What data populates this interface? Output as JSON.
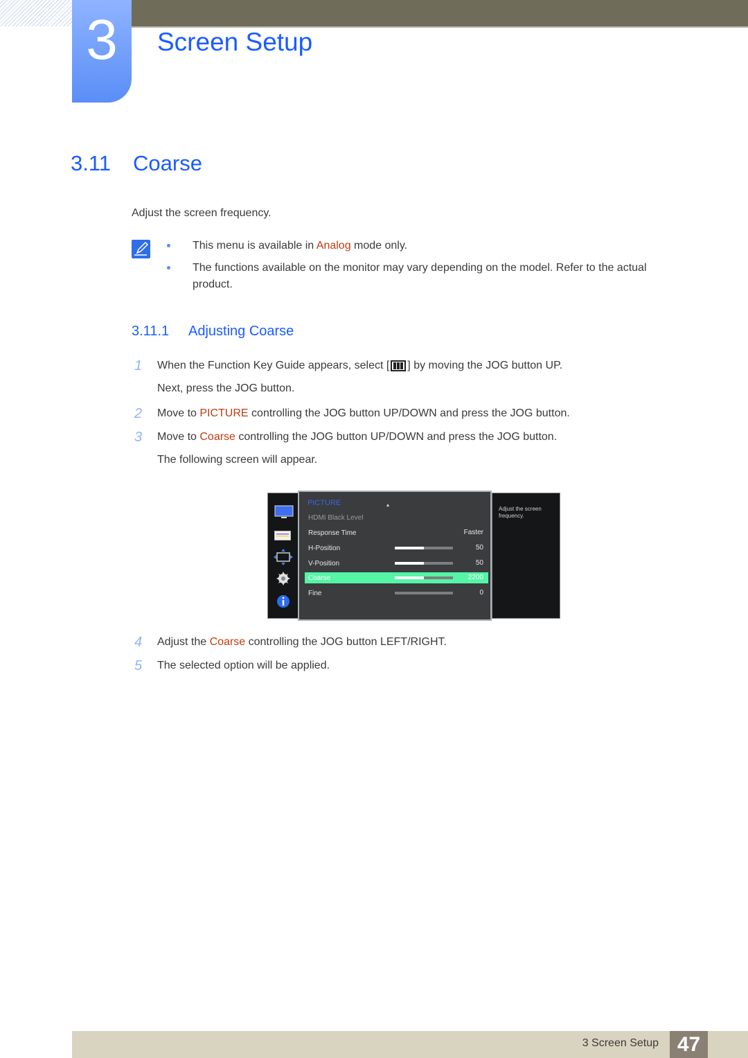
{
  "chapter": {
    "number": "3",
    "title": "Screen Setup"
  },
  "section": {
    "number": "3.11",
    "title": "Coarse",
    "intro": "Adjust the screen frequency."
  },
  "notes": [
    {
      "before": "This menu is available in ",
      "highlight": "Analog",
      "after": " mode only."
    },
    {
      "before": "The functions available on the monitor may vary depending on the model. Refer to the actual product.",
      "highlight": "",
      "after": ""
    }
  ],
  "subsection": {
    "number": "3.11.1",
    "title": "Adjusting Coarse"
  },
  "steps": [
    {
      "n": "1",
      "before": "When the Function Key Guide appears, select [",
      "after": "] by moving the JOG button UP.",
      "cont": "Next, press the JOG button."
    },
    {
      "n": "2",
      "before": "Move to ",
      "highlight": "PICTURE",
      "after": " controlling the JOG button UP/DOWN and press the JOG button."
    },
    {
      "n": "3",
      "before": "Move to ",
      "highlight": "Coarse",
      "after": " controlling the JOG button UP/DOWN and press the JOG button.",
      "cont": "The following screen will appear."
    },
    {
      "n": "4",
      "before": "Adjust the ",
      "highlight": "Coarse",
      "after": " controlling the JOG button LEFT/RIGHT."
    },
    {
      "n": "5",
      "before": "The selected option will be applied."
    }
  ],
  "osd": {
    "menu_title": "PICTURE",
    "icons": [
      "monitor-icon",
      "picture-settings-icon",
      "resize-icon",
      "gear-icon",
      "info-icon"
    ],
    "rows": [
      {
        "label": "HDMI Black Level",
        "value": "",
        "bar": null,
        "state": "disabled"
      },
      {
        "label": "Response Time",
        "value": "Faster",
        "bar": null,
        "state": "normal"
      },
      {
        "label": "H-Position",
        "value": "50",
        "bar": 0.5,
        "state": "normal"
      },
      {
        "label": "V-Position",
        "value": "50",
        "bar": 0.5,
        "state": "normal"
      },
      {
        "label": "Coarse",
        "value": "2200",
        "bar": 0.5,
        "state": "selected"
      },
      {
        "label": "Fine",
        "value": "0",
        "bar": 0,
        "state": "normal"
      }
    ],
    "help_text": "Adjust the screen frequency.",
    "highlight_color": "#55f4a6"
  },
  "footer": {
    "label": "3 Screen Setup",
    "page": "47"
  },
  "colors": {
    "heading": "#1a5cff",
    "highlight": "#c23a0e",
    "step_number": "#8fb3ff"
  }
}
